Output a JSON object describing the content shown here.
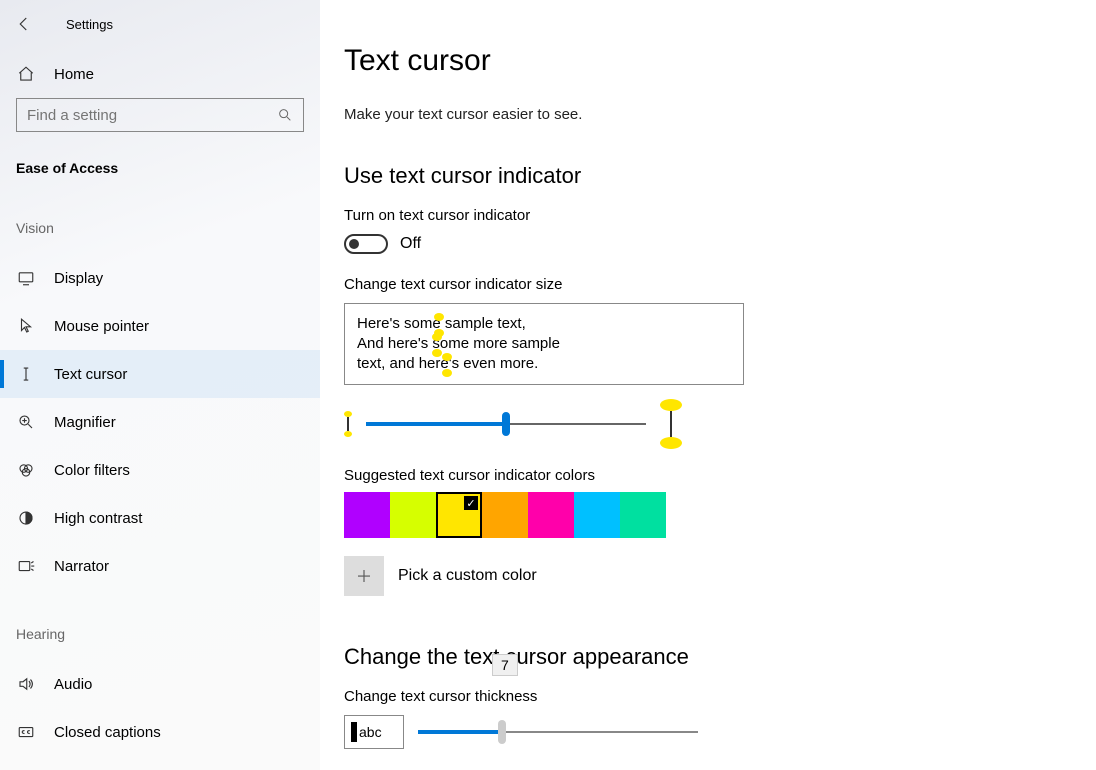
{
  "app": {
    "title": "Settings"
  },
  "sidebar": {
    "home": "Home",
    "search_placeholder": "Find a setting",
    "ease_label": "Ease of Access",
    "vision_label": "Vision",
    "hearing_label": "Hearing",
    "items_vision": [
      {
        "label": "Display",
        "icon": "display-icon"
      },
      {
        "label": "Mouse pointer",
        "icon": "mouse-pointer-icon"
      },
      {
        "label": "Text cursor",
        "icon": "text-cursor-icon",
        "active": true
      },
      {
        "label": "Magnifier",
        "icon": "magnifier-icon"
      },
      {
        "label": "Color filters",
        "icon": "color-filters-icon"
      },
      {
        "label": "High contrast",
        "icon": "high-contrast-icon"
      },
      {
        "label": "Narrator",
        "icon": "narrator-icon"
      }
    ],
    "items_hearing": [
      {
        "label": "Audio",
        "icon": "audio-icon"
      },
      {
        "label": "Closed captions",
        "icon": "closed-captions-icon"
      }
    ]
  },
  "main": {
    "title": "Text cursor",
    "subtitle": "Make your text cursor easier to see.",
    "section_indicator": "Use text cursor indicator",
    "toggle_label": "Turn on text cursor indicator",
    "toggle_state": "Off",
    "size_label": "Change text cursor indicator size",
    "preview_lines": [
      "Here's some sample text,",
      "And here's some more sample",
      "text, and here's even more."
    ],
    "colors_label": "Suggested text cursor indicator colors",
    "colors": [
      "#b000ff",
      "#d6ff00",
      "#ffe600",
      "#ffa500",
      "#ff00aa",
      "#00c0ff",
      "#00e0a0"
    ],
    "selected_color_index": 2,
    "custom_label": "Pick a custom color",
    "section_appearance": "Change the text cursor appearance",
    "thickness_label": "Change text cursor thickness",
    "thickness_preview": "abc",
    "thickness_value": "7"
  }
}
